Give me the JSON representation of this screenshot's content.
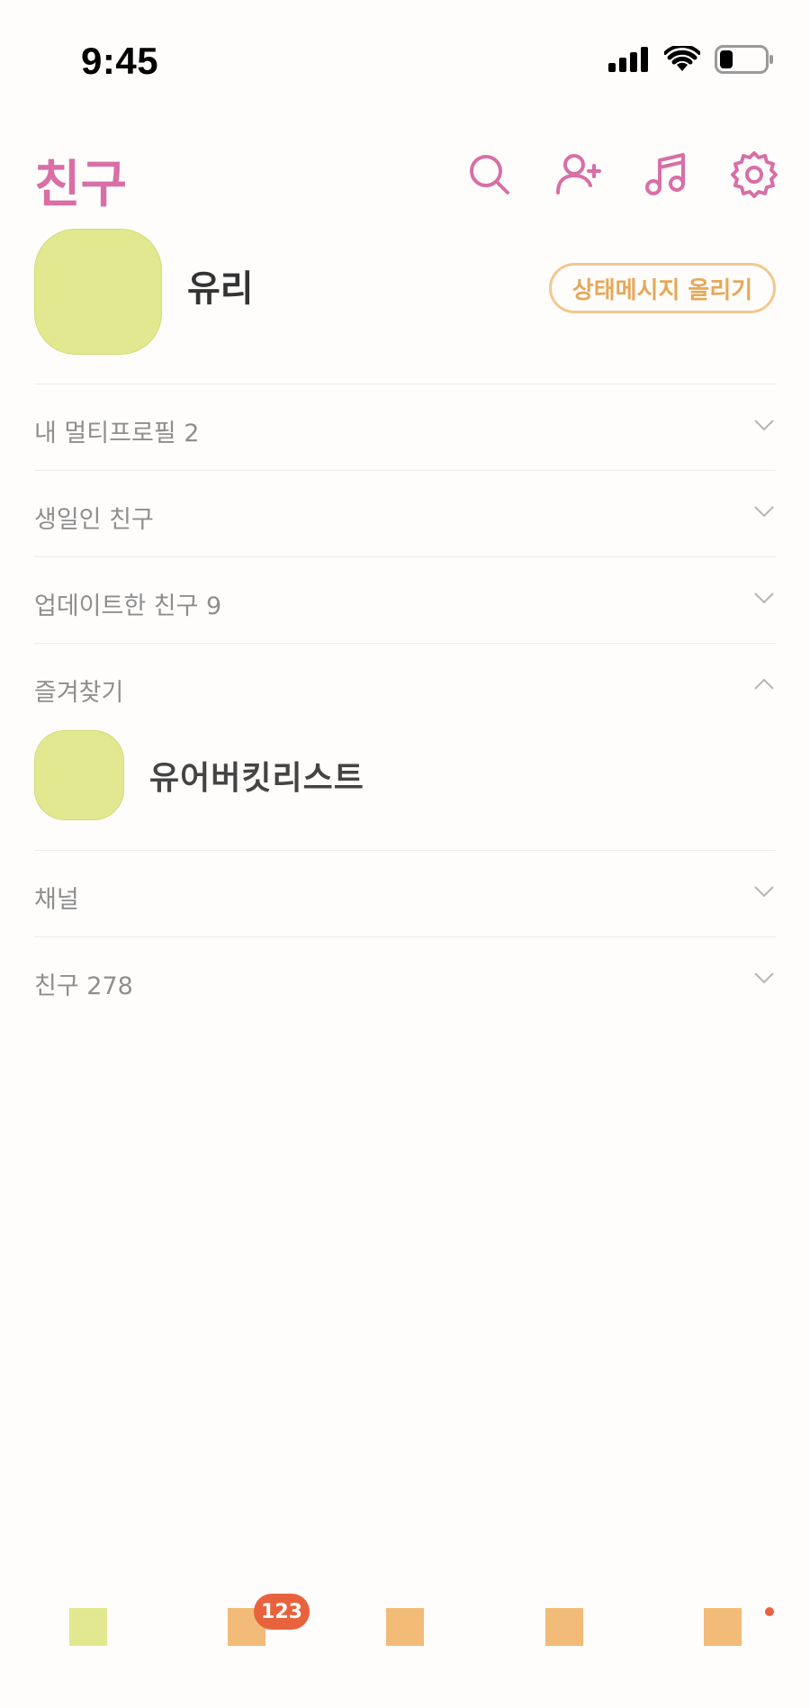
{
  "status_bar": {
    "time": "9:45",
    "icons": [
      "signal-icon",
      "wifi-icon",
      "battery-icon"
    ]
  },
  "header": {
    "title": "친구",
    "title_color": "#d86fa6",
    "icons": [
      "search-icon",
      "add-friend-icon",
      "music-icon",
      "settings-icon"
    ]
  },
  "profile": {
    "name": "유리",
    "avatar_color": "#e2e88f",
    "status_button_label": "상태메시지 올리기"
  },
  "sections": [
    {
      "label": "내 멀티프로필 2",
      "expanded": false
    },
    {
      "label": "생일인 친구",
      "expanded": false
    },
    {
      "label": "업데이트한 친구 9",
      "expanded": false
    },
    {
      "label": "즐겨찾기",
      "expanded": true
    },
    {
      "label": "채널",
      "expanded": false
    },
    {
      "label": "친구 278",
      "expanded": false
    }
  ],
  "favorites": [
    {
      "name": "유어버킷리스트",
      "avatar_color": "#e2e88f"
    }
  ],
  "tabbar": {
    "tabs": [
      {
        "name": "friends-tab",
        "color": "#e2e88f"
      },
      {
        "name": "chats-tab",
        "color": "#f2bb78"
      },
      {
        "name": "view-tab",
        "color": "#f2bb78"
      },
      {
        "name": "shopping-tab",
        "color": "#f2bb78"
      },
      {
        "name": "more-tab",
        "color": "#f2bb78"
      }
    ],
    "chat_badge": "123",
    "badge_color": "#e8633d"
  }
}
